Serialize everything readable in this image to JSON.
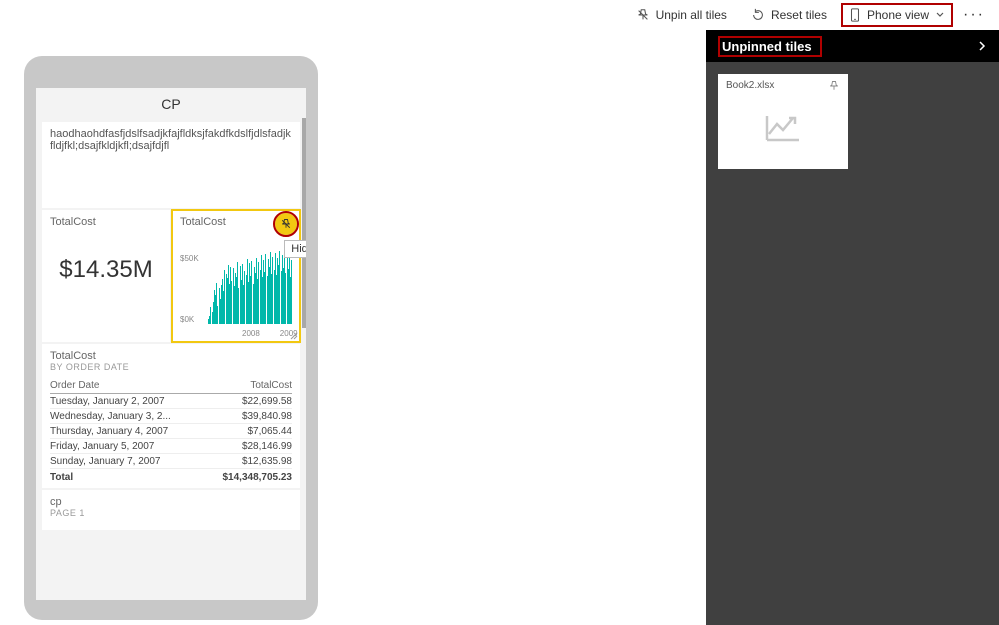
{
  "toolbar": {
    "unpin_all": "Unpin all tiles",
    "reset": "Reset tiles",
    "phone_view": "Phone view"
  },
  "panel": {
    "title": "Unpinned tiles",
    "card_title": "Book2.xlsx"
  },
  "tooltip": "Hide tile",
  "dashboard": {
    "title": "CP",
    "text_tile": "haodhaohdfasfjdslfsadjkfajfldksjfakdfkdslfjdlsfadjkfldjfkl;dsajfkldjkfl;dsajfdjfl",
    "kpi_label": "TotalCost",
    "kpi_value": "$14.35M",
    "chart_label": "TotalCost",
    "chart_y_top": "$50K",
    "chart_y_bottom": "$0K",
    "chart_x1": "2008",
    "chart_x2": "2009",
    "table_title": "TotalCost",
    "table_subtitle": "BY ORDER DATE",
    "col1": "Order Date",
    "col2": "TotalCost",
    "rows": [
      {
        "d": "Tuesday, January 2, 2007",
        "v": "$22,699.58"
      },
      {
        "d": "Wednesday, January 3, 2...",
        "v": "$39,840.98"
      },
      {
        "d": "Thursday, January 4, 2007",
        "v": "$7,065.44"
      },
      {
        "d": "Friday, January 5, 2007",
        "v": "$28,146.99"
      },
      {
        "d": "Sunday, January 7, 2007",
        "v": "$12,635.98"
      }
    ],
    "total_label": "Total",
    "total_value": "$14,348,705.23",
    "page_title": "cp",
    "page_sub": "PAGE 1"
  },
  "chart_data": {
    "type": "bar",
    "title": "TotalCost",
    "ylabel": "",
    "ylim": [
      0,
      60000
    ],
    "x_range": [
      "2007",
      "2010"
    ],
    "x_ticks_shown": [
      "2008",
      "2009"
    ],
    "values": [
      5,
      8,
      17,
      12,
      22,
      34,
      29,
      42,
      18,
      37,
      25,
      40,
      46,
      33,
      55,
      51,
      47,
      60,
      41,
      58,
      44,
      57,
      39,
      52,
      48,
      63,
      36,
      59,
      45,
      61,
      40,
      54,
      50,
      66,
      43,
      62,
      49,
      64,
      41,
      58,
      52,
      67,
      46,
      63,
      55,
      70,
      48,
      65,
      53,
      71,
      49,
      66,
      58,
      73,
      51,
      68,
      55,
      72,
      50,
      67,
      60,
      74,
      54,
      70,
      57,
      75,
      52,
      69,
      56,
      72,
      48,
      65
    ]
  }
}
